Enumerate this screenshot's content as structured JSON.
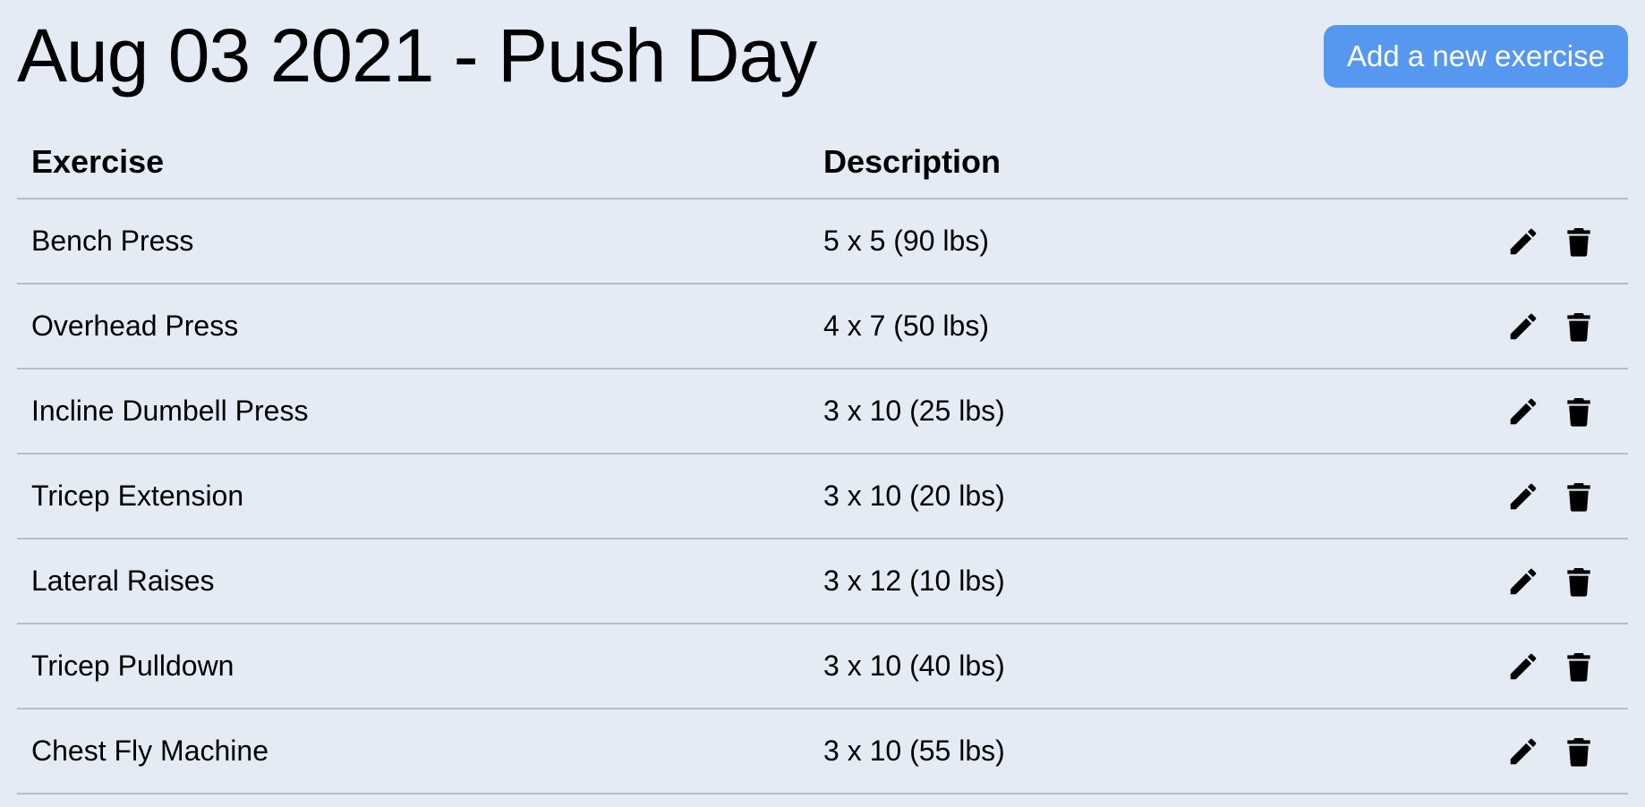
{
  "theme": {
    "background": "#e4ebf4",
    "accent": "#5697f0",
    "divider": "#b9bcc0"
  },
  "header": {
    "title": "Aug 03 2021 - Push Day",
    "add_button_label": "Add a new exercise"
  },
  "table": {
    "columns": {
      "exercise": "Exercise",
      "description": "Description"
    },
    "rows": [
      {
        "exercise": "Bench Press",
        "description": "5 x 5 (90 lbs)"
      },
      {
        "exercise": "Overhead Press",
        "description": "4 x 7 (50 lbs)"
      },
      {
        "exercise": "Incline Dumbell Press",
        "description": "3 x 10 (25 lbs)"
      },
      {
        "exercise": "Tricep Extension",
        "description": "3 x 10 (20 lbs)"
      },
      {
        "exercise": "Lateral Raises",
        "description": "3 x 12 (10 lbs)"
      },
      {
        "exercise": "Tricep Pulldown",
        "description": "3 x 10 (40 lbs)"
      },
      {
        "exercise": "Chest Fly Machine",
        "description": "3 x 10 (55 lbs)"
      }
    ],
    "row_icons": {
      "edit": "pencil-icon",
      "delete": "trash-icon"
    }
  }
}
